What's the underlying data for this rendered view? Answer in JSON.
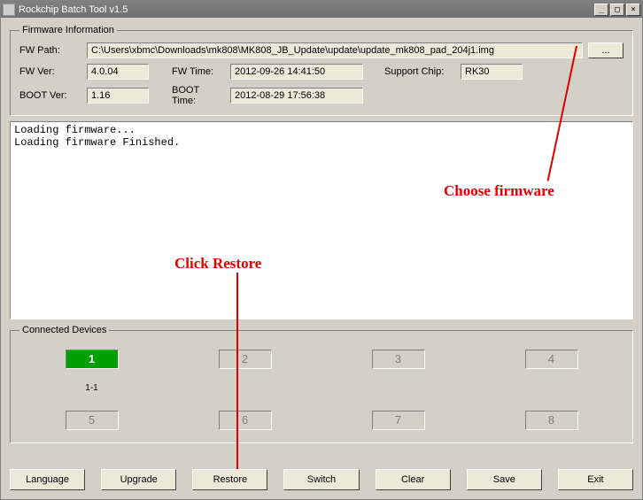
{
  "window": {
    "title": "Rockchip Batch Tool v1.5"
  },
  "firmware": {
    "legend": "Firmware Information",
    "path_label": "FW Path:",
    "path_value": "C:\\Users\\xbmc\\Downloads\\mk808\\MK808_JB_Update\\update\\update_mk808_pad_204j1.img",
    "browse_label": "...",
    "ver_label": "FW Ver:",
    "ver_value": "4.0.04",
    "time_label": "FW Time:",
    "time_value": "2012-09-26 14:41:50",
    "chip_label": "Support Chip:",
    "chip_value": "RK30",
    "bootver_label": "BOOT Ver:",
    "bootver_value": "1.16",
    "boottime_label": "BOOT Time:",
    "boottime_value": "2012-08-29 17:56:38"
  },
  "log": {
    "line1": "Loading firmware...",
    "line2": "Loading firmware Finished."
  },
  "devices": {
    "legend": "Connected Devices",
    "slots": [
      "1",
      "2",
      "3",
      "4",
      "5",
      "6",
      "7",
      "8"
    ],
    "active_label": "1-1"
  },
  "buttons": {
    "language": "Language",
    "upgrade": "Upgrade",
    "restore": "Restore",
    "switch": "Switch",
    "clear": "Clear",
    "save": "Save",
    "exit": "Exit"
  },
  "annotations": {
    "choose": "Choose firmware",
    "restore": "Click Restore"
  }
}
